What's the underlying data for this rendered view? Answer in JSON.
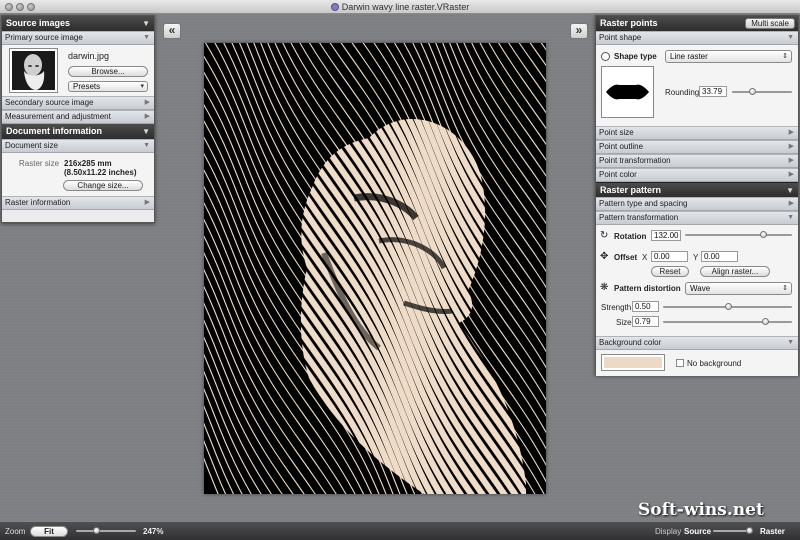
{
  "window": {
    "title": "Darwin wavy line raster.VRaster"
  },
  "nav": {
    "left": "«",
    "right": "»"
  },
  "left_panel": {
    "source_images": {
      "header": "Source images",
      "primary_label": "Primary source image",
      "file_name": "darwin.jpg",
      "browse_label": "Browse...",
      "presets_label": "Presets",
      "secondary_label": "Secondary source image",
      "measurement_label": "Measurement and adjustment"
    },
    "doc_info": {
      "header": "Document information",
      "doc_size_label": "Document size",
      "raster_size_label": "Raster size",
      "raster_size_mm": "216x285 mm",
      "raster_size_in": "(8.50x11.22 inches)",
      "change_size_label": "Change size...",
      "raster_info_label": "Raster information"
    }
  },
  "right_panel": {
    "raster_points": {
      "header": "Raster points",
      "multi_scale": "Multi scale",
      "point_shape_label": "Point shape",
      "shape_type_label": "Shape type",
      "shape_type_value": "Line raster",
      "rounding_label": "Rounding",
      "rounding_value": "33.79",
      "rounding_fraction": 0.34,
      "point_size_label": "Point size",
      "point_outline_label": "Point outline",
      "point_transformation_label": "Point transformation",
      "point_color_label": "Point color"
    },
    "raster_pattern": {
      "header": "Raster pattern",
      "pattern_type_label": "Pattern type and spacing",
      "pattern_transformation_label": "Pattern transformation",
      "rotation_label": "Rotation",
      "rotation_value": "132.00",
      "rotation_fraction": 0.73,
      "offset_label": "Offset",
      "offset_x_label": "X",
      "offset_x_value": "0.00",
      "offset_y_label": "Y",
      "offset_y_value": "0.00",
      "reset_label": "Reset",
      "align_raster_label": "Align raster...",
      "distortion_label": "Pattern distortion",
      "distortion_value": "Wave",
      "strength_label": "Strength",
      "strength_value": "0.50",
      "strength_fraction": 0.5,
      "size_label": "Size",
      "size_value": "0.79",
      "size_fraction": 0.79
    },
    "background": {
      "label": "Background color",
      "color": "#ecd9c6",
      "no_background_label": "No background"
    }
  },
  "canvas": {
    "line_color": "#efdcc8",
    "bg_color": "#000000"
  },
  "status": {
    "zoom_label": "Zoom",
    "fit_label": "Fit",
    "zoom_value": "247%",
    "zoom_fraction": 0.33,
    "display_label": "Display",
    "source_label": "Source",
    "raster_label": "Raster"
  },
  "watermark": "Soft-wins.net"
}
